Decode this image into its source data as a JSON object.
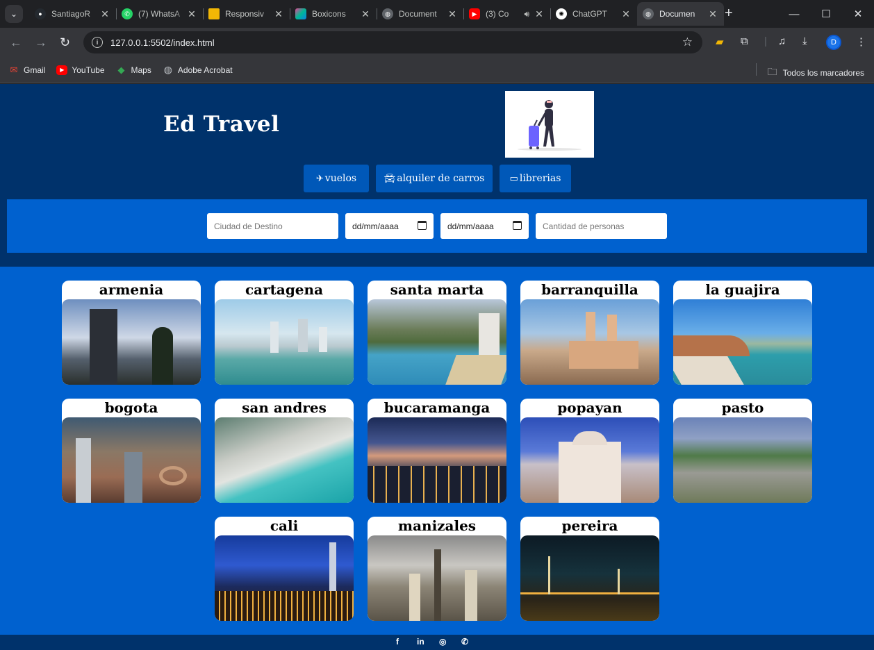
{
  "browser": {
    "tabs": [
      {
        "title": "SantiagoR",
        "icon": "github-icon",
        "color": "#24292f",
        "close": "✕"
      },
      {
        "title": "(7) WhatsA",
        "icon": "whatsapp-icon",
        "color": "#25d366",
        "close": "✕"
      },
      {
        "title": "Responsiv",
        "icon": "responsive-icon",
        "color": "#f2b705",
        "close": "✕"
      },
      {
        "title": "Boxicons",
        "icon": "boxicons-icon",
        "color": "#5d3fd3",
        "close": "✕"
      },
      {
        "title": "Document",
        "icon": "globe-icon",
        "color": "#5f6368",
        "close": "✕"
      },
      {
        "title": "(3) Co",
        "icon": "youtube-icon",
        "color": "#ff0000",
        "close": "✕"
      },
      {
        "title": "ChatGPT",
        "icon": "chatgpt-icon",
        "color": "#ffffff",
        "close": "✕"
      },
      {
        "title": "Documen",
        "icon": "globe-icon",
        "color": "#5f6368",
        "close": "✕"
      }
    ],
    "url": "127.0.0.1:5502/index.html",
    "avatar_letter": "D",
    "bookmarks": [
      {
        "label": "Gmail",
        "icon": "gmail-icon",
        "color": "#ea4335"
      },
      {
        "label": "YouTube",
        "icon": "youtube-icon",
        "color": "#ff0000"
      },
      {
        "label": "Maps",
        "icon": "maps-icon",
        "color": "#34a853"
      },
      {
        "label": "Adobe Acrobat",
        "icon": "globe-icon",
        "color": "#9aa0a6"
      }
    ],
    "all_bookmarks": "Todos los marcadores"
  },
  "site": {
    "brand": "Ed Travel",
    "menu": [
      {
        "label": "vuelos",
        "icon": "plane-icon"
      },
      {
        "label": "alquiler de carros",
        "icon": "car-icon"
      },
      {
        "label": "librerias",
        "icon": "book-icon"
      }
    ],
    "search": {
      "destination_placeholder": "Ciudad de Destino",
      "date_placeholder": "dd/mm/aaaa",
      "people_placeholder": "Cantidad de personas"
    },
    "destinations": [
      "armenia",
      "cartagena",
      "santa marta",
      "barranquilla",
      "la guajira",
      "bogota",
      "san andres",
      "bucaramanga",
      "popayan",
      "pasto",
      "cali",
      "manizales",
      "pereira"
    ],
    "social": [
      "facebook-icon",
      "linkedin-icon",
      "instagram-icon",
      "whatsapp-icon"
    ]
  },
  "colors": {
    "header_bg": "#00326b",
    "page_bg": "#0061cf",
    "menu_bg": "#0058b8"
  }
}
